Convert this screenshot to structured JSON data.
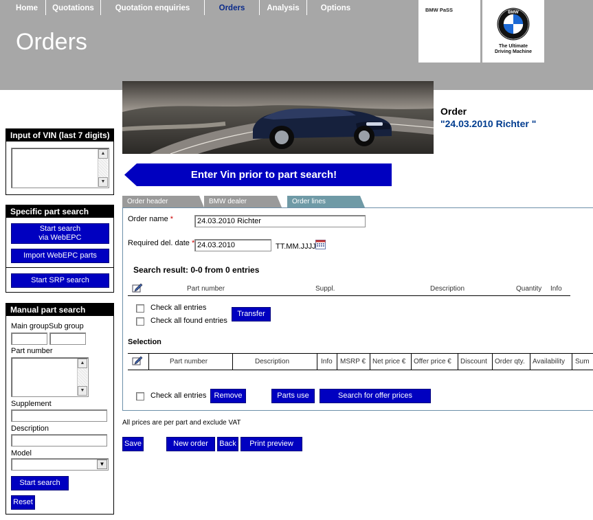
{
  "nav": {
    "items": [
      "Home",
      "Quotations",
      "Quotation enquiries",
      "Orders",
      "Analysis",
      "Options"
    ],
    "active": "Orders"
  },
  "header": {
    "page_title": "Orders",
    "app_label": "BMW PaSS",
    "bmw_logo_text": "BMW",
    "tagline_line1": "The Ultimate",
    "tagline_line2": "Driving Machine"
  },
  "vin_panel": {
    "title": "Input of VIN (last 7 digits)",
    "value": ""
  },
  "specific_search": {
    "title": "Specific part search",
    "start_search_line1": "Start search",
    "start_search_line2": "via WebEPC",
    "import_label": "Import WebEPC parts",
    "srp_label": "Start SRP search"
  },
  "manual_search": {
    "title": "Manual part search",
    "main_group_label": "Main group",
    "sub_group_label": "Sub group",
    "main_group_value": "",
    "sub_group_value": "",
    "part_number_label": "Part number",
    "supplement_label": "Supplement",
    "description_label": "Description",
    "model_label": "Model",
    "model_value": "",
    "start_search_label": "Start search",
    "reset_label": "Reset"
  },
  "order": {
    "title": "Order",
    "subtitle": "\"24.03.2010 Richter \"",
    "vin_notice": "Enter Vin prior to part search!",
    "tabs": [
      "Order header",
      "BMW dealer",
      "Order lines"
    ],
    "active_tab": "Order lines",
    "order_name_label": "Order name",
    "order_name_value": "24.03.2010 Richter",
    "req_date_label": "Required del. date",
    "req_date_value": "24.03.2010",
    "date_format": "TT.MM.JJJJ",
    "required_mark": "*"
  },
  "search_result": {
    "title": "Search result: 0-0 from 0 entries",
    "columns": [
      "Part number",
      "Suppl.",
      "Description",
      "Quantity",
      "Info"
    ],
    "check_all_entries": "Check all entries",
    "check_all_found": "Check all found entries",
    "transfer_label": "Transfer"
  },
  "selection": {
    "title": "Selection",
    "columns": [
      "Part number",
      "Description",
      "Info",
      "MSRP €",
      "Net price €",
      "Offer price €",
      "Discount",
      "Order qty.",
      "Availability",
      "Sum"
    ],
    "check_all_entries": "Check all entries",
    "remove_label": "Remove",
    "parts_use_label": "Parts use",
    "offer_prices_label": "Search for offer prices"
  },
  "footer": {
    "vat_note": "All prices are per part and exclude VAT",
    "save_label": "Save",
    "new_order_label": "New order",
    "back_label": "Back",
    "print_preview_label": "Print preview"
  },
  "colors": {
    "header_gray": "#a7a7a7",
    "button_blue": "#0000c0",
    "order_blue": "#003c8f",
    "tab_gray": "#9a9a9a",
    "tab_active": "#6f9aa6"
  }
}
